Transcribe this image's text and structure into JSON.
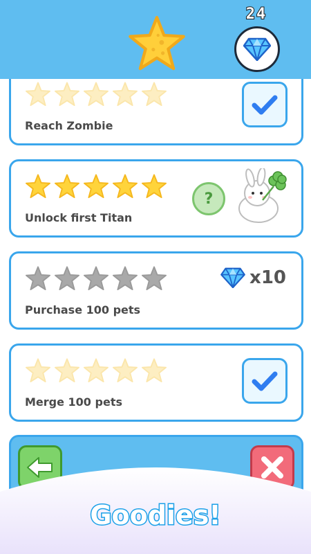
{
  "header": {
    "gem_count": "24"
  },
  "achievements": [
    {
      "label": "Reach Zombie",
      "stars_state": "faded",
      "status": "claimed"
    },
    {
      "label": "Unlock first Titan",
      "stars_state": "gold",
      "status": "mystery-reward"
    },
    {
      "label": "Purchase 100 pets",
      "stars_state": "gray",
      "status": "locked",
      "reward_qty": "x10"
    },
    {
      "label": "Merge 100 pets",
      "stars_state": "faded",
      "status": "claimed"
    }
  ],
  "mystery_symbol": "?",
  "banner": {
    "title": "Goodies!"
  },
  "colors": {
    "header": "#5fbdf0",
    "card_border": "#3aa6ec",
    "star_gold": "#ffd43b",
    "star_faded": "#fdeec2",
    "star_gray": "#a9a9a9",
    "check": "#2f7df0"
  },
  "icons": {
    "header_star": "star-icon",
    "gem": "diamond-icon",
    "check": "checkmark-icon",
    "back": "arrow-left-icon",
    "close": "x-icon",
    "pet": "bunny-with-clover-icon"
  }
}
